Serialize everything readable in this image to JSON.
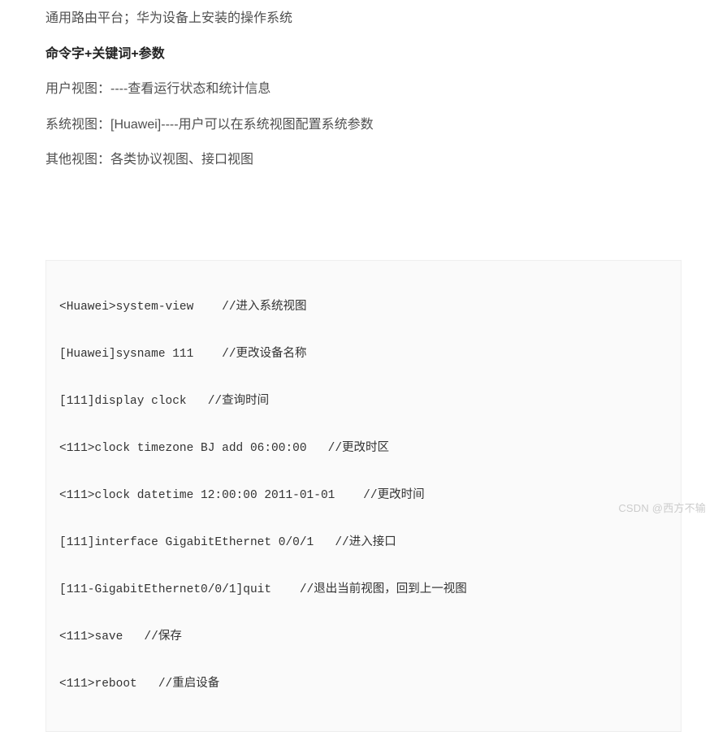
{
  "paragraphs": {
    "p1": "通用路由平台；华为设备上安装的操作系统",
    "p2_bold": "命令字+关键词+参数",
    "p3": "用户视图：----查看运行状态和统计信息",
    "p4": "系统视图：[Huawei]----用户可以在系统视图配置系统参数",
    "p5": "其他视图：各类协议视图、接口视图"
  },
  "code_lines": [
    "<Huawei>system-view    //进入系统视图",
    "[Huawei]sysname 111    //更改设备名称",
    "[111]display clock   //查询时间",
    "<111>clock timezone BJ add 06:00:00   //更改时区",
    "<111>clock datetime 12:00:00 2011-01-01    //更改时间",
    "[111]interface GigabitEthernet 0/0/1   //进入接口",
    "[111-GigabitEthernet0/0/1]quit    //退出当前视图，回到上一视图",
    "<111>save   //保存",
    "<111>reboot   //重启设备"
  ],
  "watermark": "CSDN @西方不输"
}
